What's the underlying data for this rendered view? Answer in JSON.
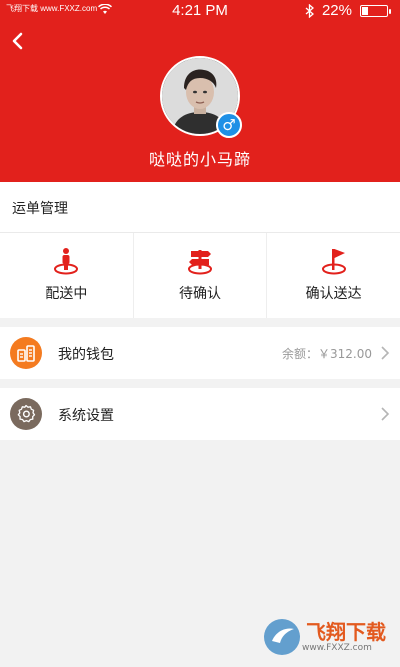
{
  "status_bar": {
    "watermark_left": "飞翔下载 www.FXXZ.com",
    "time": "4:21 PM",
    "battery": "22%",
    "battery_fraction": 0.22
  },
  "header": {
    "username": "哒哒的小马蹄",
    "gender_symbol": "♂",
    "accent_color": "#e2211c"
  },
  "orders": {
    "title": "运单管理",
    "tabs": [
      {
        "label": "配送中",
        "icon": "person-pin-icon"
      },
      {
        "label": "待确认",
        "icon": "signpost-icon"
      },
      {
        "label": "确认送达",
        "icon": "flag-pin-icon"
      }
    ]
  },
  "wallet": {
    "label": "我的钱包",
    "balance": "余额：￥312.00",
    "icon": "wallet-icon",
    "icon_color": "#f47b20"
  },
  "settings": {
    "label": "系统设置",
    "icon": "gear-icon",
    "icon_color": "#7a6a5e"
  },
  "watermark": {
    "title": "飞翔下载",
    "url": "www.FXXZ.com"
  }
}
